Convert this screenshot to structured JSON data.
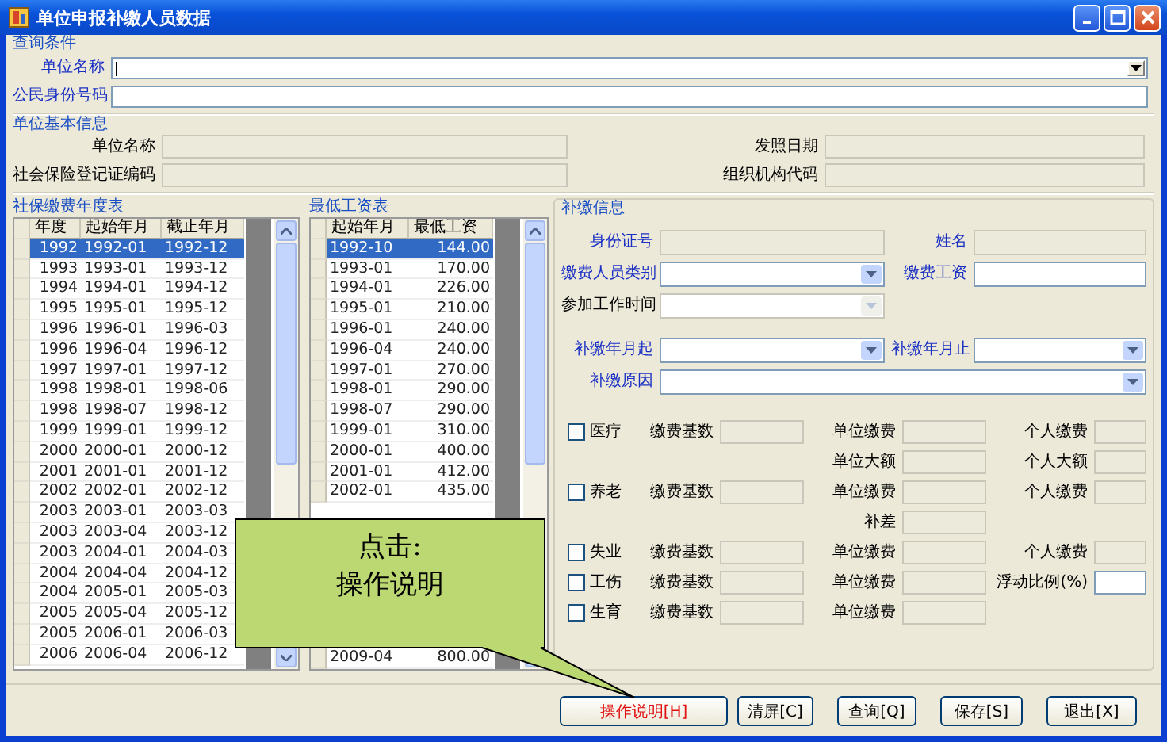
{
  "window": {
    "title": "单位申报补缴人员数据"
  },
  "query": {
    "title": "查询条件",
    "fields": [
      {
        "label": "单位名称",
        "kind": "combo",
        "required": true,
        "disabled": false
      },
      {
        "label": "公民身份号码",
        "kind": "text",
        "required": true,
        "disabled": false
      }
    ]
  },
  "unit_info": {
    "title": "单位基本信息",
    "rows": [
      {
        "fields": [
          {
            "label": "单位名称",
            "disabled": true
          },
          {
            "label": "发照日期",
            "disabled": true
          }
        ]
      },
      {
        "fields": [
          {
            "label": "社会保险登记证编码",
            "disabled": true
          },
          {
            "label": "组织机构代码",
            "disabled": true
          }
        ]
      }
    ]
  },
  "yearly_table": {
    "title": "社保缴费年度表",
    "columns": [
      "年度",
      "起始年月",
      "截止年月"
    ],
    "rows": [
      {
        "cells": [
          "1992",
          "1992-01",
          "1992-12"
        ],
        "selected": true
      },
      {
        "cells": [
          "1993",
          "1993-01",
          "1993-12"
        ],
        "selected": false
      },
      {
        "cells": [
          "1994",
          "1994-01",
          "1994-12"
        ],
        "selected": false
      },
      {
        "cells": [
          "1995",
          "1995-01",
          "1995-12"
        ],
        "selected": false
      },
      {
        "cells": [
          "1996",
          "1996-01",
          "1996-03"
        ],
        "selected": false
      },
      {
        "cells": [
          "1996",
          "1996-04",
          "1996-12"
        ],
        "selected": false
      },
      {
        "cells": [
          "1997",
          "1997-01",
          "1997-12"
        ],
        "selected": false
      },
      {
        "cells": [
          "1998",
          "1998-01",
          "1998-06"
        ],
        "selected": false
      },
      {
        "cells": [
          "1998",
          "1998-07",
          "1998-12"
        ],
        "selected": false
      },
      {
        "cells": [
          "1999",
          "1999-01",
          "1999-12"
        ],
        "selected": false
      },
      {
        "cells": [
          "2000",
          "2000-01",
          "2000-12"
        ],
        "selected": false
      },
      {
        "cells": [
          "2001",
          "2001-01",
          "2001-12"
        ],
        "selected": false
      },
      {
        "cells": [
          "2002",
          "2002-01",
          "2002-12"
        ],
        "selected": false
      },
      {
        "cells": [
          "2003",
          "2003-01",
          "2003-03"
        ],
        "selected": false
      },
      {
        "cells": [
          "2003",
          "2003-04",
          "2003-12"
        ],
        "selected": false
      },
      {
        "cells": [
          "2003",
          "2004-01",
          "2004-03"
        ],
        "selected": false
      },
      {
        "cells": [
          "2004",
          "2004-04",
          "2004-12"
        ],
        "selected": false
      },
      {
        "cells": [
          "2004",
          "2005-01",
          "2005-03"
        ],
        "selected": false
      },
      {
        "cells": [
          "2005",
          "2005-04",
          "2005-12"
        ],
        "selected": false
      },
      {
        "cells": [
          "2005",
          "2006-01",
          "2006-03"
        ],
        "selected": false
      },
      {
        "cells": [
          "2006",
          "2006-04",
          "2006-12"
        ],
        "selected": false
      }
    ]
  },
  "wage_table": {
    "title": "最低工资表",
    "columns": [
      "起始年月",
      "最低工资"
    ],
    "rows": [
      {
        "cells": [
          "1992-10",
          "144.00"
        ],
        "selected": true
      },
      {
        "cells": [
          "1993-01",
          "170.00"
        ],
        "selected": false
      },
      {
        "cells": [
          "1994-01",
          "226.00"
        ],
        "selected": false
      },
      {
        "cells": [
          "1995-01",
          "210.00"
        ],
        "selected": false
      },
      {
        "cells": [
          "1996-01",
          "240.00"
        ],
        "selected": false
      },
      {
        "cells": [
          "1996-04",
          "240.00"
        ],
        "selected": false
      },
      {
        "cells": [
          "1997-01",
          "270.00"
        ],
        "selected": false
      },
      {
        "cells": [
          "1998-01",
          "290.00"
        ],
        "selected": false
      },
      {
        "cells": [
          "1998-07",
          "290.00"
        ],
        "selected": false
      },
      {
        "cells": [
          "1999-01",
          "310.00"
        ],
        "selected": false
      },
      {
        "cells": [
          "2000-01",
          "400.00"
        ],
        "selected": false
      },
      {
        "cells": [
          "2001-01",
          "412.00"
        ],
        "selected": false
      },
      {
        "cells": [
          "2002-01",
          "435.00"
        ],
        "selected": false
      }
    ],
    "bottom_rows": [
      {
        "cells": [
          "2009-04",
          "800.00"
        ],
        "selected": false
      }
    ]
  },
  "supplement": {
    "title": "补缴信息",
    "rows": [
      {
        "fields": [
          {
            "label": "身份证号",
            "kind": "text",
            "required": true,
            "disabled": true
          },
          {
            "label": "姓名",
            "kind": "text",
            "required": true,
            "disabled": true
          }
        ]
      },
      {
        "fields": [
          {
            "label": "缴费人员类别",
            "kind": "combo",
            "required": true,
            "disabled": false
          },
          {
            "label": "缴费工资",
            "kind": "text",
            "required": true,
            "disabled": false
          }
        ]
      },
      {
        "fields": [
          {
            "label": "参加工作时间",
            "kind": "combo",
            "required": false,
            "disabled": true
          }
        ]
      },
      {
        "fields": [
          {
            "label": "补缴年月起",
            "kind": "combo",
            "required": true,
            "disabled": false
          },
          {
            "label": "补缴年月止",
            "kind": "combo",
            "required": true,
            "disabled": false
          }
        ]
      },
      {
        "fields": [
          {
            "label": "补缴原因",
            "kind": "combo",
            "required": true,
            "disabled": false,
            "wide": true
          }
        ]
      }
    ],
    "insurance": [
      {
        "checkbox": {
          "label": "医疗",
          "checked": false
        },
        "cells": [
          {
            "kind": "base",
            "label": "缴费基数",
            "disabled": true
          },
          {
            "kind": "unit",
            "label": "单位缴费",
            "disabled": true
          },
          {
            "kind": "personal",
            "label": "个人缴费",
            "disabled": true
          }
        ]
      },
      {
        "cells": [
          {
            "kind": "unit",
            "label": "单位大额",
            "disabled": true
          },
          {
            "kind": "personal",
            "label": "个人大额",
            "disabled": true
          }
        ]
      },
      {
        "checkbox": {
          "label": "养老",
          "checked": false
        },
        "cells": [
          {
            "kind": "base",
            "label": "缴费基数",
            "disabled": true
          },
          {
            "kind": "unit",
            "label": "单位缴费",
            "disabled": true
          },
          {
            "kind": "personal",
            "label": "个人缴费",
            "disabled": true
          }
        ]
      },
      {
        "cells": [
          {
            "kind": "unit",
            "label": "补差",
            "disabled": true
          }
        ]
      },
      {
        "checkbox": {
          "label": "失业",
          "checked": false
        },
        "cells": [
          {
            "kind": "base",
            "label": "缴费基数",
            "disabled": true
          },
          {
            "kind": "unit",
            "label": "单位缴费",
            "disabled": true
          },
          {
            "kind": "personal",
            "label": "个人缴费",
            "disabled": true
          }
        ]
      },
      {
        "checkbox": {
          "label": "工伤",
          "checked": false
        },
        "cells": [
          {
            "kind": "base",
            "label": "缴费基数",
            "disabled": true
          },
          {
            "kind": "unit",
            "label": "单位缴费",
            "disabled": true
          },
          {
            "kind": "personal",
            "label": "浮动比例(%)",
            "disabled": false
          }
        ]
      },
      {
        "checkbox": {
          "label": "生育",
          "checked": false
        },
        "cells": [
          {
            "kind": "base",
            "label": "缴费基数",
            "disabled": true
          },
          {
            "kind": "unit",
            "label": "单位缴费",
            "disabled": true
          }
        ]
      }
    ]
  },
  "callout": {
    "lines": [
      "点击:",
      "操作说明"
    ]
  },
  "buttons": [
    {
      "label": "操作说明[H]",
      "highlighted": true
    },
    {
      "label": "清屏[C]",
      "highlighted": false
    },
    {
      "label": "查询[Q]",
      "highlighted": false
    },
    {
      "label": "保存[S]",
      "highlighted": false
    },
    {
      "label": "退出[X]",
      "highlighted": false
    }
  ]
}
